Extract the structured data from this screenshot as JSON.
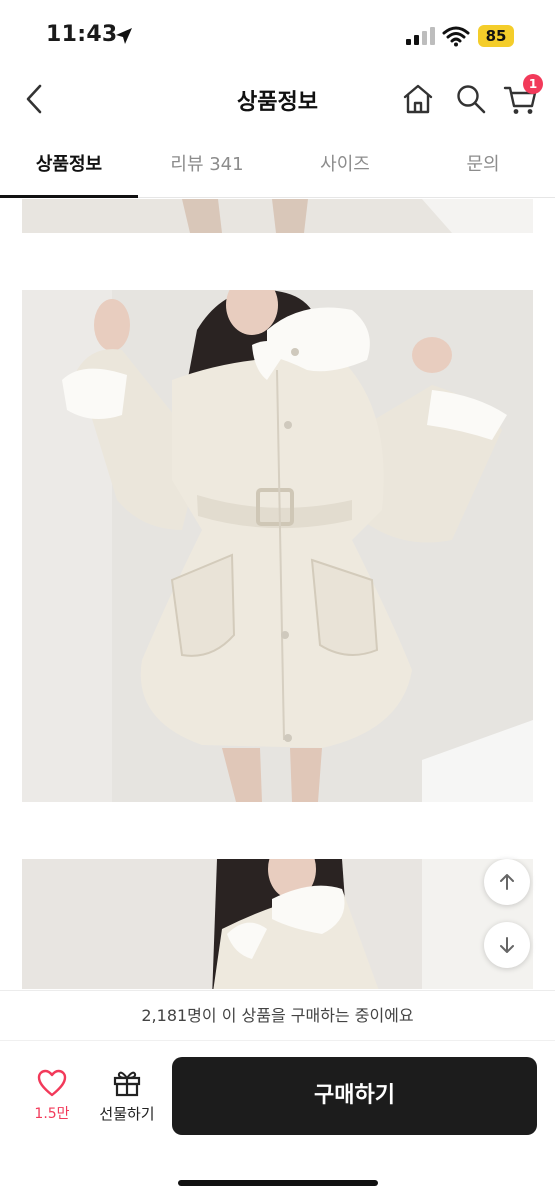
{
  "status": {
    "time": "11:43",
    "battery": "85"
  },
  "header": {
    "title": "상품정보",
    "cart_count": "1"
  },
  "tabs": [
    {
      "label": "상품정보",
      "active": true
    },
    {
      "label": "리뷰 341",
      "active": false
    },
    {
      "label": "사이즈",
      "active": false
    },
    {
      "label": "문의",
      "active": false
    }
  ],
  "colors": {
    "accent": "#f23a5a",
    "buy_button": "#1c1c1c",
    "battery": "#f4cd2a"
  },
  "notice": "2,181명이 이 상품을 구매하는 중이에요",
  "actions": {
    "like_count": "1.5만",
    "gift_label": "선물하기",
    "buy_label": "구매하기"
  }
}
